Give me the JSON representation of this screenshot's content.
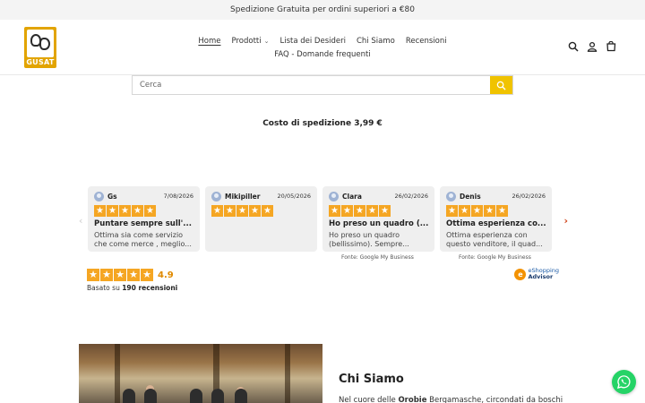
{
  "announcement": "Spedizione Gratuita per ordini superiori a €80",
  "logo": {
    "text": "GUSAT",
    "color": "#e2a400"
  },
  "nav": {
    "row1": [
      {
        "label": "Home",
        "active": true
      },
      {
        "label": "Prodotti",
        "has_dropdown": true
      },
      {
        "label": "Lista dei Desideri"
      },
      {
        "label": "Chi Siamo"
      },
      {
        "label": "Recensioni"
      }
    ],
    "row2": [
      {
        "label": "FAQ - Domande frequenti"
      }
    ]
  },
  "header_icons": [
    "search-icon",
    "user-icon",
    "cart-icon"
  ],
  "search": {
    "placeholder": "Cerca",
    "value": "",
    "button_icon": "search-icon",
    "button_color": "#f0c300"
  },
  "shipping_text": "Costo di spedizione 3,99 €",
  "reviews": {
    "cards": [
      {
        "name": "Gs",
        "date": "7/08/2026",
        "rating": 5,
        "title": "Puntare sempre sull'...",
        "text": "Ottima sia come servizio che come merce , meglio...",
        "source": ""
      },
      {
        "name": "Mikipiller",
        "date": "20/05/2026",
        "rating": 5,
        "title": "",
        "text": "",
        "source": ""
      },
      {
        "name": "Clara",
        "date": "26/02/2026",
        "rating": 5,
        "title": "Ho preso un quadro (...",
        "text": "Ho preso un quadro (bellissimo). Sempre...",
        "source": "Fonte: Google My Business"
      },
      {
        "name": "Denis",
        "date": "26/02/2026",
        "rating": 5,
        "title": "Ottima esperienza co...",
        "text": "Ottima esperienza con questo venditore, il quad...",
        "source": "Fonte: Google My Business"
      }
    ],
    "summary": {
      "score": "4.9",
      "based_prefix": "Basato su",
      "count_text": "190 recensioni"
    },
    "badge": {
      "line1": "eShopping",
      "line2": "Advisor"
    },
    "star_color": "#f5a623"
  },
  "about": {
    "title": "Chi Siamo",
    "text_pre": "Nel cuore delle",
    "text_bold": "Orobie",
    "text_post": "Bergamasche, circondati da boschi"
  },
  "whatsapp": {
    "icon": "whatsapp-icon",
    "color": "#25d366"
  }
}
